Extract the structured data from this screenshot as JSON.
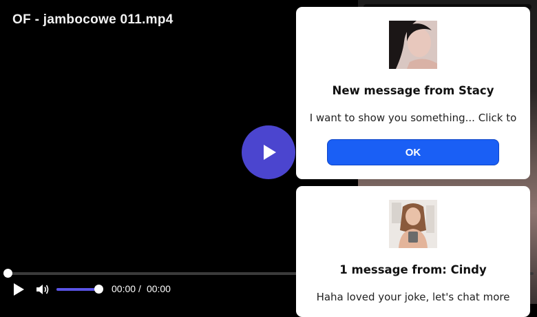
{
  "video": {
    "title": "OF - jambocowe 011.mp4",
    "current_time": "00:00",
    "separator": "/",
    "duration": "00:00",
    "progress": 0,
    "volume": 1.0,
    "accent_color": "#4b45cf"
  },
  "popups": [
    {
      "title": "New message from Stacy",
      "text": "I want to show you something... Click to",
      "button_label": "OK",
      "button_color": "#1a5ff5"
    },
    {
      "title": "1 message from: Cindy",
      "text": "Haha loved your joke, let's chat more"
    }
  ],
  "icons": {
    "play": "play-icon",
    "volume": "volume-icon",
    "big_play": "play-icon"
  }
}
